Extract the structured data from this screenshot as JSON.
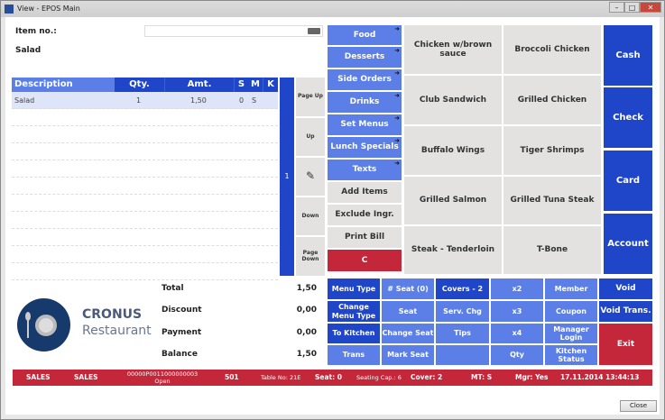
{
  "window": {
    "title": "View - EPOS Main",
    "minimize": "–",
    "maximize": "□",
    "close": "✕"
  },
  "item": {
    "label": "Item no.:",
    "value": "",
    "selected": "Salad"
  },
  "table": {
    "headers": [
      "Description",
      "Qty.",
      "Amt.",
      "S",
      "M",
      "K"
    ],
    "rows": [
      {
        "description": "Salad",
        "qty": "1",
        "amt": "1,50",
        "s": "0",
        "m": "S",
        "k": ""
      }
    ]
  },
  "line_counter": "1",
  "nav": {
    "page_up": "Page Up",
    "up": "Up",
    "down": "Down",
    "page_down": "Page Down"
  },
  "categories": [
    {
      "label": "Food",
      "arrow": true
    },
    {
      "label": "Desserts",
      "arrow": true
    },
    {
      "label": "Side Orders",
      "arrow": true
    },
    {
      "label": "Drinks",
      "arrow": true
    },
    {
      "label": "Set Menus",
      "arrow": true
    },
    {
      "label": "Lunch Specials",
      "arrow": true
    },
    {
      "label": "Texts",
      "arrow": true
    }
  ],
  "actions": {
    "add_items": "Add Items",
    "exclude": "Exclude Ingr.",
    "print_bill": "Print Bill",
    "clear": "C"
  },
  "items": [
    "Chicken w/brown sauce",
    "Broccoli Chicken",
    "Club Sandwich",
    "Grilled Chicken",
    "Buffalo Wings",
    "Tiger Shrimps",
    "Grilled Salmon",
    "Grilled Tuna Steak",
    "Steak - Tenderloin",
    "T-Bone"
  ],
  "payments": [
    "Cash",
    "Check",
    "Card",
    "Account"
  ],
  "functions": {
    "menu_type": "Menu Type",
    "seat_count": "# Seat (0)",
    "covers": "Covers - 2",
    "x2": "x2",
    "member": "Member",
    "void": "Void",
    "change_menu_type": "Change Menu Type",
    "seat": "Seat",
    "serv_chg": "Serv. Chg",
    "x3": "x3",
    "coupon": "Coupon",
    "void_trans": "Void Trans.",
    "to_kitchen": "To Kitchen",
    "change_seat": "Change Seat",
    "tips": "Tips",
    "x4": "x4",
    "manager_login": "Manager Login",
    "exit": "Exit",
    "trans": "Trans",
    "mark_seat": "Mark Seat",
    "blank": "",
    "qty": "Qty",
    "kitchen_status": "Kitchen Status"
  },
  "totals": {
    "total_label": "Total",
    "total": "1,50",
    "discount_label": "Discount",
    "discount": "0,00",
    "payment_label": "Payment",
    "payment": "0,00",
    "balance_label": "Balance",
    "balance": "1,50"
  },
  "logo": {
    "brand": "CRONUS",
    "sub": "Restaurant"
  },
  "status": {
    "f1": "SALES",
    "f2": "SALES",
    "receipt": "00000P0011000000003",
    "state": "Open",
    "terminal": "501",
    "table": "Table No: 21E",
    "seat": "Seat: 0",
    "capacity": "Seating Cap.: 6",
    "cover": "Cover: 2",
    "mt": "MT: S",
    "mgr": "Mgr: Yes",
    "datetime": "17.11.2014 13:44:13"
  },
  "close_button": "Close",
  "colors": {
    "dark_blue": "#1f45c9",
    "light_blue": "#5b7fe6",
    "red": "#c4263a",
    "grey": "#e3e2e0"
  }
}
